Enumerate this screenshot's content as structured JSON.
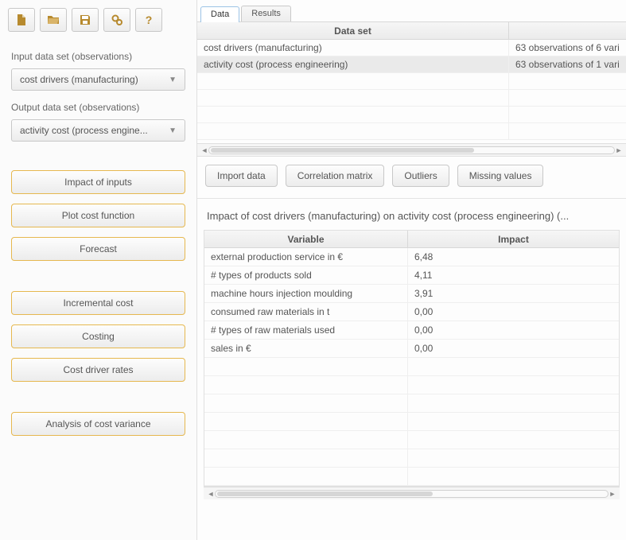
{
  "toolbar_icons": [
    "new-file-icon",
    "open-folder-icon",
    "save-disk-icon",
    "gears-icon",
    "help-icon"
  ],
  "sidebar": {
    "input_label": "Input data set (observations)",
    "input_value": "cost drivers (manufacturing)",
    "output_label": "Output data set (observations)",
    "output_value": "activity cost (process engine...",
    "actions": [
      "Impact of inputs",
      "Plot cost function",
      "Forecast",
      "Incremental cost",
      "Costing",
      "Cost driver rates",
      "Analysis of cost variance"
    ]
  },
  "tabs": {
    "t0": "Data",
    "t1": "Results",
    "active": 0
  },
  "datasets": {
    "header": "Data set",
    "rows": [
      {
        "name": "cost drivers (manufacturing)",
        "info": "63 observations of 6 vari",
        "selected": false
      },
      {
        "name": "activity cost (process engineering)",
        "info": "63 observations of 1 vari",
        "selected": true
      }
    ]
  },
  "mid_buttons": [
    "Import data",
    "Correlation matrix",
    "Outliers",
    "Missing values"
  ],
  "impact": {
    "title": "Impact of cost drivers (manufacturing) on activity cost (process engineering) (...",
    "col_variable": "Variable",
    "col_impact": "Impact",
    "rows": [
      {
        "v": "external production service in €",
        "i": "6,48"
      },
      {
        "v": "# types of products sold",
        "i": "4,11"
      },
      {
        "v": "machine hours injection moulding",
        "i": "3,91"
      },
      {
        "v": "consumed raw materials in t",
        "i": "0,00"
      },
      {
        "v": "# types of raw materials used",
        "i": "0,00"
      },
      {
        "v": "sales in €",
        "i": "0,00"
      }
    ]
  },
  "icon_color": "#b78a2e"
}
